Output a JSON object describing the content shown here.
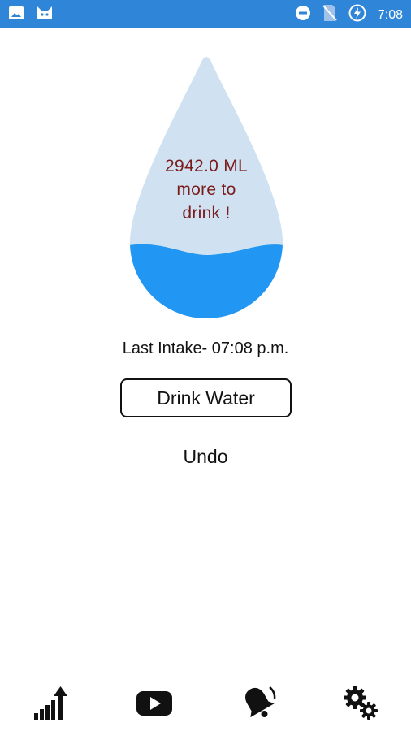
{
  "status_bar": {
    "time": "7:08",
    "left_icons": [
      "image-icon",
      "android-cat-icon"
    ],
    "right_icons": [
      "do-not-disturb-icon",
      "no-sim-icon",
      "battery-charging-icon"
    ]
  },
  "water": {
    "remaining_text_line1": "2942.0 ML",
    "remaining_text_line2": "more to",
    "remaining_text_line3": "drink !",
    "fill_fraction": 0.28,
    "water_color": "#2196f3",
    "drop_color": "#d0e2f1"
  },
  "last_intake": "Last Intake- 07:08 p.m.",
  "actions": {
    "drink_label": "Drink Water",
    "undo_label": "Undo"
  },
  "nav": {
    "items": [
      "stats-icon",
      "youtube-icon",
      "bell-icon",
      "settings-icon"
    ]
  }
}
